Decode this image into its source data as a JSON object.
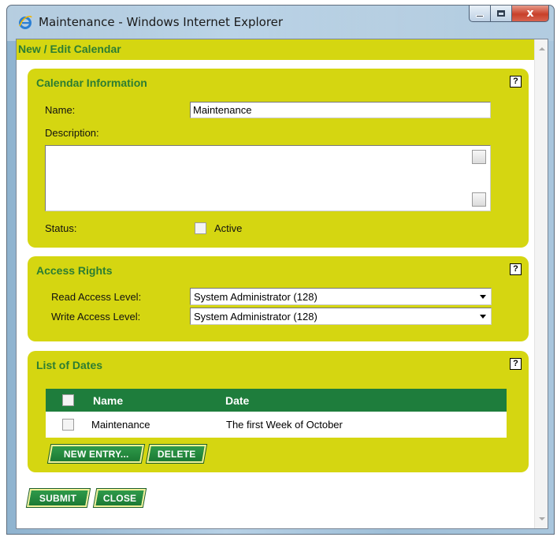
{
  "window": {
    "title": "Maintenance - Windows Internet Explorer",
    "close_glyph": "x"
  },
  "page": {
    "header": "New / Edit Calendar"
  },
  "calendar_info": {
    "title": "Calendar Information",
    "help": "?",
    "name_label": "Name:",
    "name_value": "Maintenance",
    "description_label": "Description:",
    "description_value": "",
    "status_label": "Status:",
    "active_label": "Active",
    "active_checked": false
  },
  "access_rights": {
    "title": "Access Rights",
    "help": "?",
    "read_label": "Read Access Level:",
    "read_value": "System Administrator (128)",
    "write_label": "Write Access Level:",
    "write_value": "System Administrator (128)"
  },
  "list_of_dates": {
    "title": "List of Dates",
    "help": "?",
    "columns": [
      "Name",
      "Date"
    ],
    "rows": [
      {
        "name": "Maintenance",
        "date": "The first Week of October"
      }
    ],
    "new_entry_label": "New Entry...",
    "delete_label": "Delete"
  },
  "footer": {
    "submit_label": "Submit",
    "close_label": "Close"
  },
  "colors": {
    "panel": "#d5d611",
    "title_green": "#2c7d32",
    "table_header": "#1e7d3c"
  }
}
